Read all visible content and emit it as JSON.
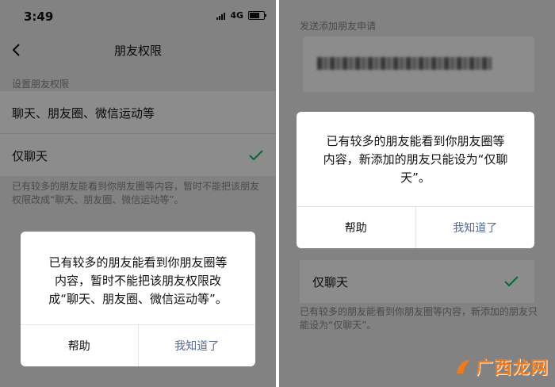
{
  "left": {
    "status_bar": {
      "time": "3:49",
      "network": "4G"
    },
    "nav": {
      "title": "朋友权限"
    },
    "section_header": "设置朋友权限",
    "options": [
      {
        "label": "聊天、朋友圈、微信运动等",
        "selected": false
      },
      {
        "label": "仅聊天",
        "selected": true
      }
    ],
    "footnote": "已有较多的朋友能看到你朋友圈等内容，暂时不能把该朋友权限改成“聊天、朋友圈、微信运动等”。",
    "dialog": {
      "message_lines": [
        "已有较多的朋友能看到你朋友圈等",
        "内容，暂时不能把该朋友权限改",
        "成“聊天、朋友圈、微信运动等”。"
      ],
      "help_label": "帮助",
      "ok_label": "我知道了"
    }
  },
  "right": {
    "section_header": "发送添加朋友申请",
    "dialog": {
      "message_lines": [
        "已有较多的朋友能看到你朋友圈等",
        "内容，新添加的朋友只能设为“仅聊",
        "天”。"
      ],
      "help_label": "帮助",
      "ok_label": "我知道了"
    },
    "option": {
      "label": "仅聊天",
      "selected": true
    },
    "footnote": "已有较多的朋友能看到你朋友圈等内容，新添加的朋友只能设为“仅聊天”。"
  },
  "watermark": {
    "text": "广西龙网"
  },
  "colors": {
    "check": "#07c160",
    "link": "#576b95",
    "watermark": "#f07a1a"
  },
  "icons": [
    "back-chevron-icon",
    "checkmark-icon",
    "signal-icon",
    "battery-icon"
  ]
}
